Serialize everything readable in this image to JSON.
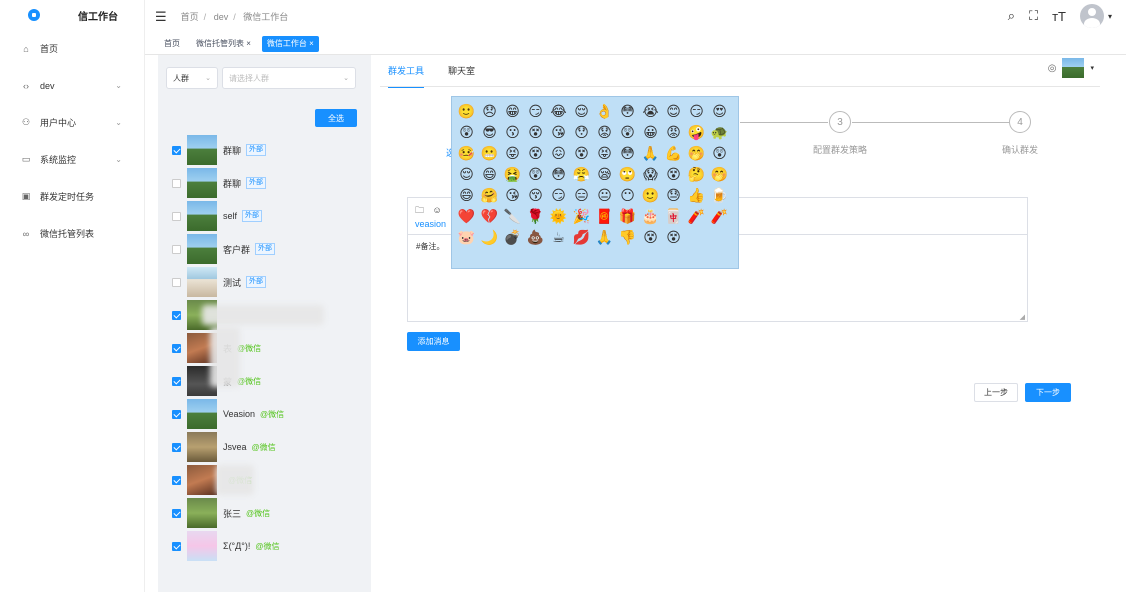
{
  "app": {
    "title": "信工作台"
  },
  "sidebar": {
    "items": [
      {
        "label": "首页",
        "icon": "home-icon",
        "glyph": "⌂"
      },
      {
        "label": "dev",
        "icon": "code-icon",
        "glyph": "‹›",
        "chevron": "⌄"
      },
      {
        "label": "用户中心",
        "icon": "users-icon",
        "glyph": "⚇",
        "chevron": "⌄"
      },
      {
        "label": "系统监控",
        "icon": "monitor-icon",
        "glyph": "▭",
        "chevron": "⌄"
      },
      {
        "label": "群发定时任务",
        "icon": "schedule-icon",
        "glyph": "▣"
      },
      {
        "label": "微信托管列表",
        "icon": "link-icon",
        "glyph": "∞"
      }
    ]
  },
  "breadcrumb": {
    "items": [
      "首页",
      "dev",
      "微信工作台"
    ]
  },
  "tags": [
    {
      "label": "首页"
    },
    {
      "label": "微信托管列表 ×"
    },
    {
      "label": "微信工作台 ×"
    }
  ],
  "panel": {
    "type_select": "人群",
    "group_placeholder": "请选择人群",
    "select_all": "全选",
    "rows": [
      {
        "name": "群聊",
        "tag": "外部",
        "wx": ""
      },
      {
        "name": "群聊",
        "tag": "外部",
        "wx": ""
      },
      {
        "name": "self",
        "tag": "外部",
        "wx": ""
      },
      {
        "name": "客户群",
        "tag": "外部",
        "wx": ""
      },
      {
        "name": "测试",
        "tag": "外部",
        "wx": ""
      },
      {
        "name": "",
        "tag": "",
        "wx": ""
      },
      {
        "name": "表",
        "tag": "",
        "wx": "@微信"
      },
      {
        "name": "蒙",
        "tag": "",
        "wx": "@微信"
      },
      {
        "name": "Veasion",
        "tag": "",
        "wx": "@微信"
      },
      {
        "name": "Jsvea",
        "tag": "",
        "wx": "@微信"
      },
      {
        "name": "",
        "tag": "",
        "wx": "@微信"
      },
      {
        "name": "张三",
        "tag": "",
        "wx": "@微信"
      },
      {
        "name": "Σ(°Д°)!",
        "tag": "",
        "wx": "@微信"
      }
    ]
  },
  "main": {
    "tabs": [
      {
        "label": "群发工具"
      },
      {
        "label": "聊天室"
      }
    ],
    "steps": [
      {
        "num": "3",
        "label": "配置群发策略"
      },
      {
        "num": "4",
        "label": "确认群发"
      }
    ],
    "step1_hint": "选",
    "editor": {
      "sender": "veasion",
      "remark": "#备注。"
    },
    "add_message": "添加消息",
    "prev": "上一步",
    "next": "下一步"
  },
  "emoji": [
    "🙂",
    "😞",
    "😁",
    "😏",
    "😂",
    "😌",
    "👌",
    "😳",
    "😭",
    "😊",
    "😏",
    "😍",
    "😲",
    "😎",
    "😗",
    "😵",
    "😘",
    "😯",
    "😟",
    "😲",
    "😀",
    "😡",
    "🤪",
    "🐢",
    "🤒",
    "😬",
    "😝",
    "😵",
    "😖",
    "😵",
    "😝",
    "😳",
    "🙏",
    "💪",
    "🤭",
    "😲",
    "😌",
    "😄",
    "🤮",
    "😲",
    "😳",
    "😤",
    "😪",
    "🙄",
    "😱",
    "😵",
    "🤔",
    "🤭",
    "😄",
    "🤗",
    "😘",
    "😚",
    "😏",
    "😑",
    "😐",
    "😶",
    "🙂",
    "😓",
    "👍",
    "🍺",
    "❤️",
    "💔",
    "🔪",
    "🌹",
    "🌞",
    "🎉",
    "🧧",
    "🎁",
    "🎂",
    "🀄",
    "🧨",
    "🧨",
    "🐷",
    "🌙",
    "💣",
    "💩",
    "☕",
    "💋",
    "🙏",
    "👎",
    "😵",
    "😵"
  ]
}
